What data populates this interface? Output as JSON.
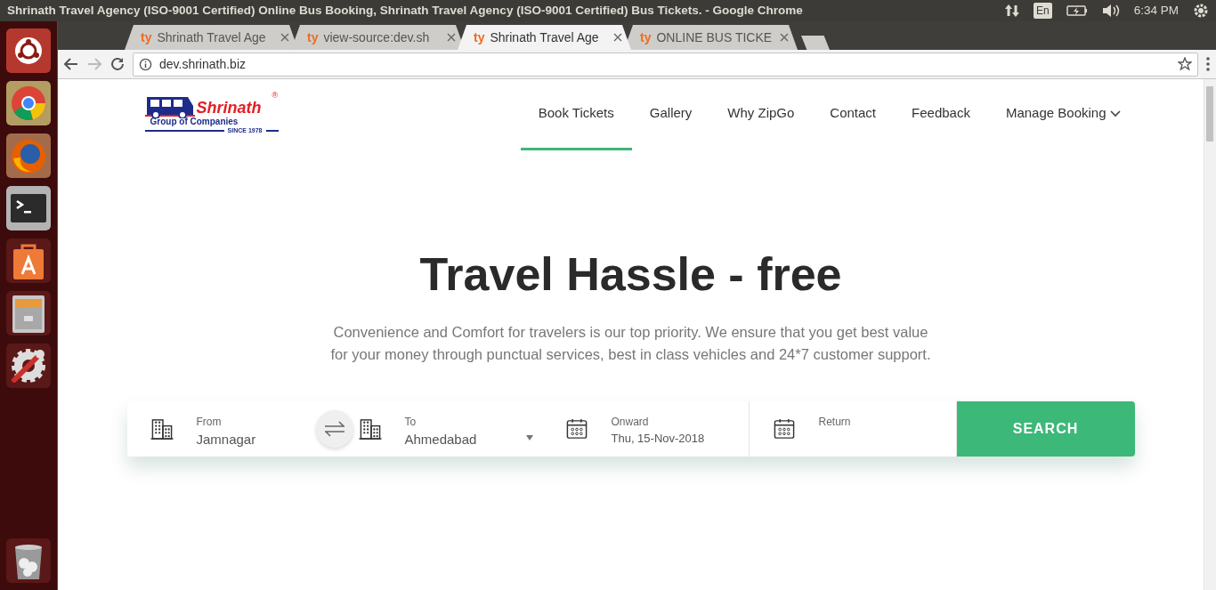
{
  "window": {
    "title": "Shrinath Travel Agency (ISO-9001 Certified) Online Bus Booking, Shrinath Travel Agency (ISO-9001 Certified) Bus Tickets. - Google Chrome"
  },
  "system_tray": {
    "keyboard": "En",
    "clock": "6:34 PM"
  },
  "launcher": [
    {
      "kind": "ubuntu"
    },
    {
      "kind": "chrome"
    },
    {
      "kind": "firefox"
    },
    {
      "kind": "terminal"
    },
    {
      "kind": "software"
    },
    {
      "kind": "files"
    },
    {
      "kind": "settings"
    },
    {
      "kind": "trash"
    }
  ],
  "tabs": [
    {
      "favicon": "ty",
      "title": "Shrinath Travel Age",
      "selected": false
    },
    {
      "favicon": "ty",
      "title": "view-source:dev.sh",
      "selected": false
    },
    {
      "favicon": "ty",
      "title": "Shrinath Travel Age",
      "selected": true
    },
    {
      "favicon": "ty",
      "title": "ONLINE BUS TICKE",
      "selected": false
    }
  ],
  "address_bar": {
    "url": "dev.shrinath.biz"
  },
  "logo": {
    "brand": "Shrinath",
    "registered": "®",
    "tagline": "Group of Companies",
    "since": "SINCE 1978"
  },
  "nav": [
    {
      "label": "Book Tickets",
      "selected": true,
      "has_menu": false
    },
    {
      "label": "Gallery",
      "selected": false,
      "has_menu": false
    },
    {
      "label": "Why ZipGo",
      "selected": false,
      "has_menu": false
    },
    {
      "label": "Contact",
      "selected": false,
      "has_menu": false
    },
    {
      "label": "Feedback",
      "selected": false,
      "has_menu": false
    },
    {
      "label": "Manage Booking",
      "selected": false,
      "has_menu": true
    }
  ],
  "hero": {
    "title": "Travel Hassle - free",
    "text": "Convenience and Comfort for travelers is our top priority. We ensure that you get best value for your money through punctual services, best in class vehicles and 24*7 customer support."
  },
  "search_form": {
    "fields": [
      {
        "kind": "city",
        "label": "From",
        "value": "Jamnagar",
        "has_menu": false
      },
      {
        "kind": "city",
        "label": "To",
        "value": "Ahmedabad",
        "has_menu": true
      },
      {
        "kind": "date",
        "label": "Onward",
        "value": "Thu, 15-Nov-2018",
        "has_menu": false
      },
      {
        "kind": "date",
        "label": "Return",
        "has_menu": false
      }
    ],
    "button": "SEARCH"
  }
}
